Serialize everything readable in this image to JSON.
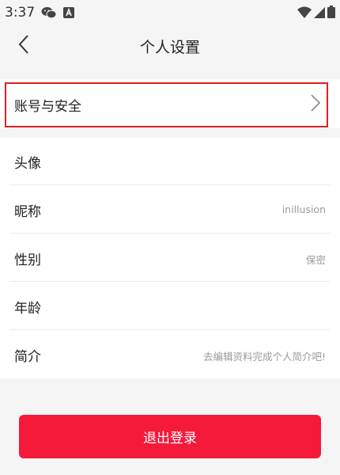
{
  "status": {
    "time": "3:37"
  },
  "header": {
    "title": "个人设置"
  },
  "account": {
    "label": "账号与安全"
  },
  "rows": [
    {
      "label": "头像",
      "value": ""
    },
    {
      "label": "昵称",
      "value": "inillusion"
    },
    {
      "label": "性别",
      "value": "保密"
    },
    {
      "label": "年龄",
      "value": ""
    },
    {
      "label": "简介",
      "value": "去编辑资料完成个人简介吧!"
    }
  ],
  "actions": {
    "logout_label": "退出登录"
  },
  "colors": {
    "accent": "#f5193a",
    "highlight": "#e02020",
    "background": "#f5f5f5"
  },
  "icons": {
    "back": "chevron-left-icon",
    "forward": "chevron-right-icon"
  }
}
